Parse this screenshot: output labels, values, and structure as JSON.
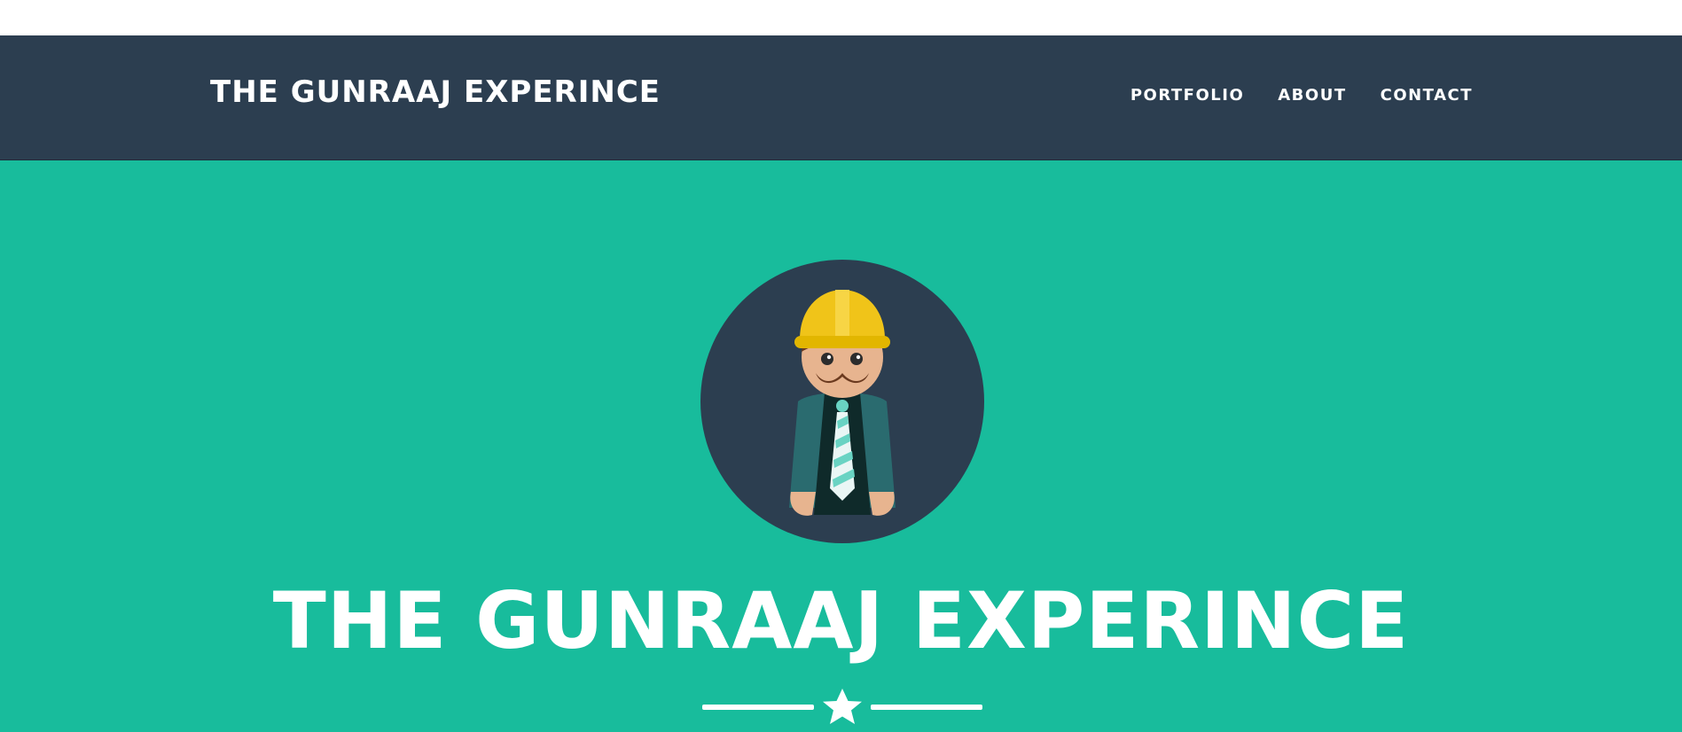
{
  "navbar": {
    "brand": "THE GUNRAAJ EXPERINCE",
    "items": [
      {
        "label": "PORTFOLIO"
      },
      {
        "label": "ABOUT"
      },
      {
        "label": "CONTACT"
      }
    ]
  },
  "hero": {
    "title": "THE GUNRAAJ EXPERINCE",
    "avatar_icon": "construction-worker-avatar-icon",
    "divider_icon": "star-icon"
  },
  "colors": {
    "navbar_bg": "#2c3e50",
    "hero_bg": "#18bc9c",
    "text": "#ffffff",
    "helmet": "#f0c419",
    "jacket": "#2a6b6f"
  }
}
